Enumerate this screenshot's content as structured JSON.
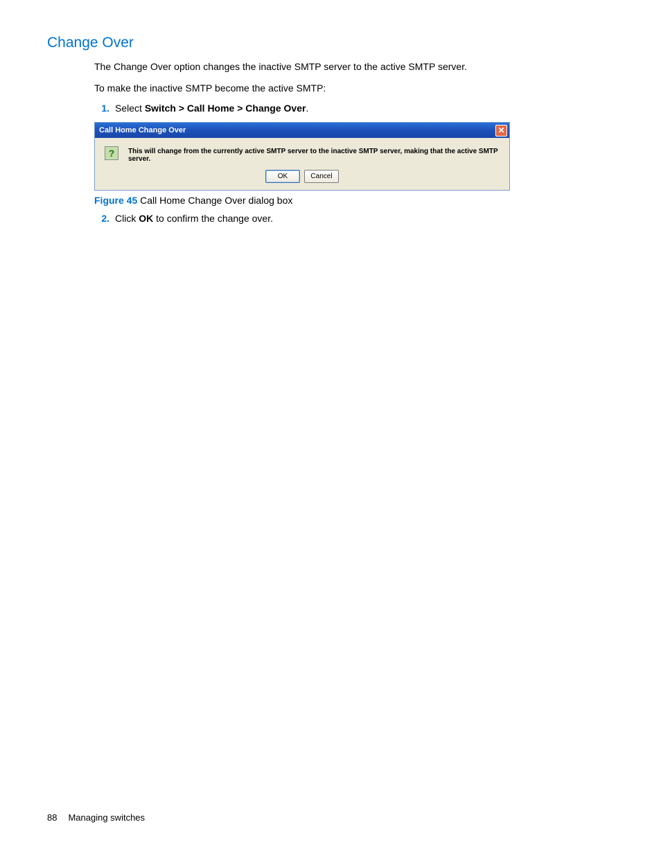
{
  "heading": "Change Over",
  "intro1": "The Change Over option changes the inactive SMTP server to the active SMTP server.",
  "intro2": "To make the inactive SMTP become the active SMTP:",
  "step1": {
    "num": "1.",
    "prefix": "Select ",
    "bold": "Switch > Call Home > Change Over",
    "suffix": "."
  },
  "dialog": {
    "title": "Call Home Change Over",
    "message": "This will change from the currently active SMTP server to the inactive SMTP server, making that the active SMTP server.",
    "ok": "OK",
    "cancel": "Cancel"
  },
  "figure": {
    "label": "Figure 45",
    "caption": " Call Home Change Over dialog box"
  },
  "step2": {
    "num": "2.",
    "prefix": "Click ",
    "bold": "OK",
    "suffix": " to confirm the change over."
  },
  "footer": {
    "page": "88",
    "section": "Managing switches"
  }
}
